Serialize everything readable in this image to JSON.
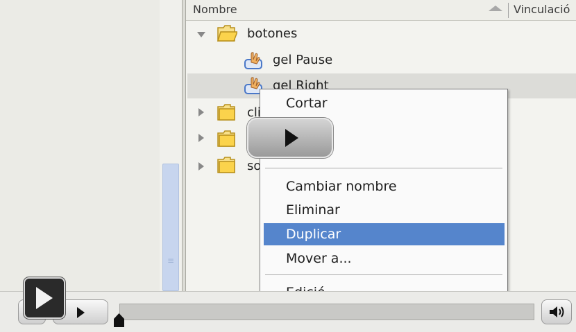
{
  "library": {
    "columns": {
      "name": "Nombre",
      "linkage": "Vinculació"
    },
    "items": [
      {
        "label": "botones",
        "type": "folder",
        "expanded": true
      },
      {
        "label": "gel Pause",
        "type": "button-symbol"
      },
      {
        "label": "gel Right",
        "type": "button-symbol",
        "selected": true
      },
      {
        "label": "cli",
        "type": "folder",
        "expanded": false
      },
      {
        "label": "",
        "type": "folder",
        "expanded": false
      },
      {
        "label": "so",
        "type": "folder",
        "expanded": false
      }
    ]
  },
  "context_menu": {
    "items": [
      "Cortar",
      "Cambiar nombre",
      "Eliminar",
      "Duplicar",
      "Mover a...",
      "Edición"
    ],
    "partial_item": "Edició",
    "highlighted": "Duplicar",
    "hidden_fragment": "g"
  },
  "colors": {
    "highlight": "#5585cc",
    "folder": "#f5c842"
  },
  "icons": {
    "play": "play-icon",
    "volume": "speaker-icon",
    "folder": "folder-icon",
    "button_symbol": "button-symbol-icon"
  }
}
